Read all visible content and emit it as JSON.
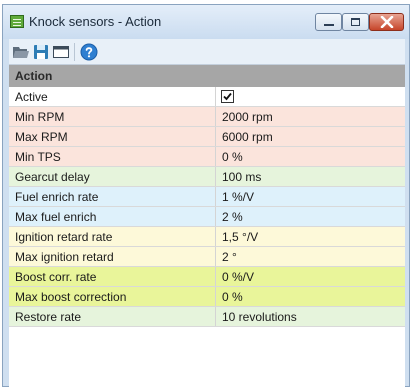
{
  "window": {
    "title": "Knock sensors - Action",
    "icon": "sensor-table-icon"
  },
  "toolbar": {
    "buttons": [
      "open-folder-icon",
      "save-icon",
      "window-icon",
      "help-icon"
    ]
  },
  "grid": {
    "section": "Action",
    "rows": [
      {
        "name": "Active",
        "checked": true,
        "color": "#ffffff"
      },
      {
        "name": "Min RPM",
        "value": "2000 rpm",
        "color": "#fbe4dc"
      },
      {
        "name": "Max RPM",
        "value": "6000 rpm",
        "color": "#fbe4dc"
      },
      {
        "name": "Min TPS",
        "value": "0 %",
        "color": "#fbe4dc"
      },
      {
        "name": "Gearcut delay",
        "value": "100 ms",
        "color": "#e6f4dc"
      },
      {
        "name": "Fuel enrich rate",
        "value": "1 %/V",
        "color": "#def1fb"
      },
      {
        "name": "Max fuel enrich",
        "value": "2 %",
        "color": "#def1fb"
      },
      {
        "name": "Ignition retard rate",
        "value": "1,5 °/V",
        "color": "#fdf9d9"
      },
      {
        "name": "Max ignition retard",
        "value": "2 °",
        "color": "#fdf9d9"
      },
      {
        "name": "Boost corr. rate",
        "value": "0 %/V",
        "color": "#e9f59a"
      },
      {
        "name": "Max boost correction",
        "value": "0 %",
        "color": "#e9f59a"
      },
      {
        "name": "Restore rate",
        "value": "10 revolutions",
        "color": "#e6f4dc"
      }
    ]
  }
}
